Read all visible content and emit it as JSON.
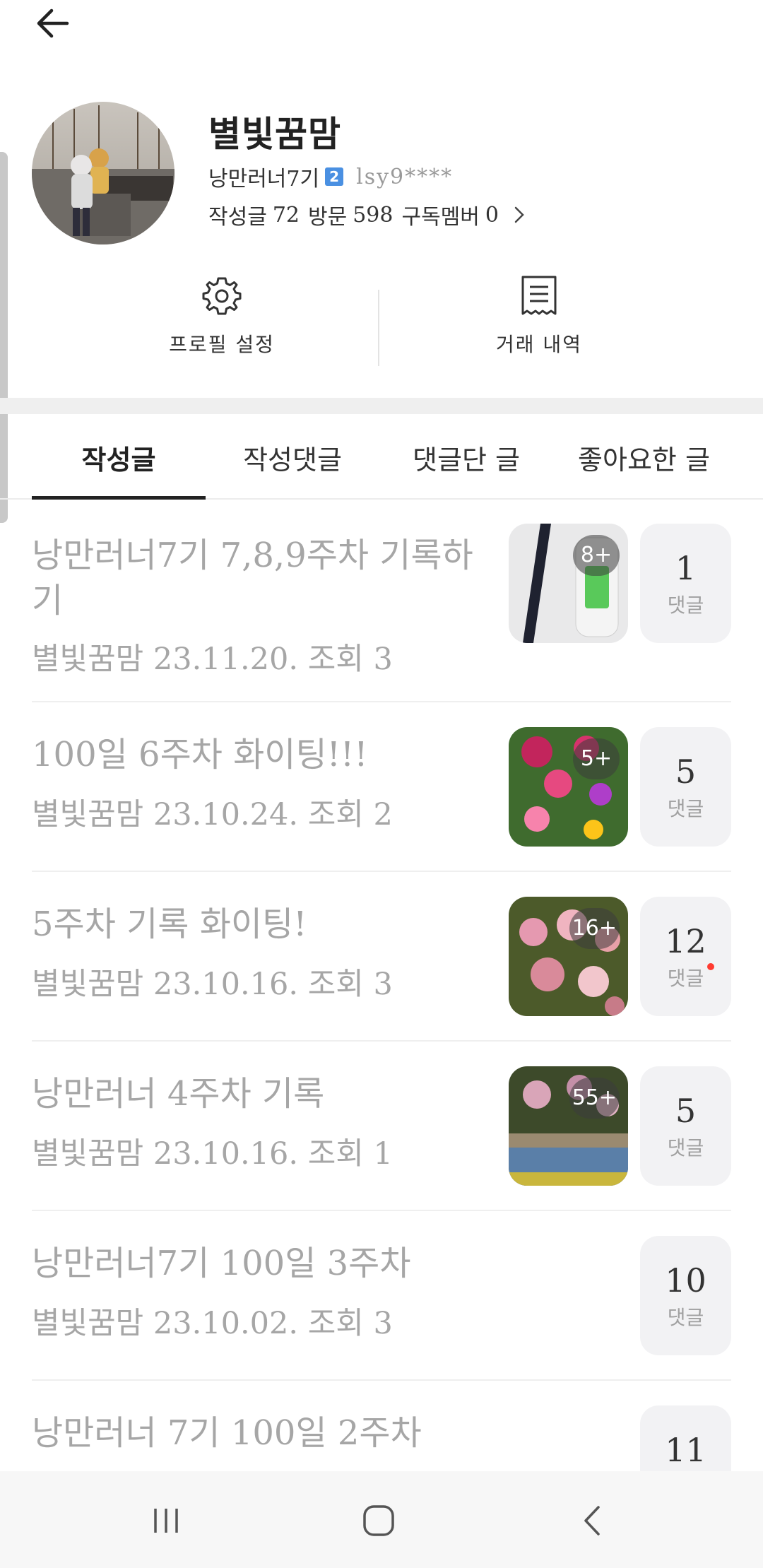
{
  "profile": {
    "nickname": "별빛꿈맘",
    "group": "낭만러너7기",
    "level": "2",
    "user_id": "lsy9****",
    "stats": {
      "posts_label": "작성글",
      "posts": "72",
      "visits_label": "방문",
      "visits": "598",
      "subscribers_label": "구독멤버",
      "subscribers": "0"
    }
  },
  "actions": {
    "profile_settings": "프로필 설정",
    "trade_history": "거래 내역"
  },
  "tabs": [
    {
      "label": "작성글",
      "active": true
    },
    {
      "label": "작성댓글",
      "active": false
    },
    {
      "label": "댓글단 글",
      "active": false
    },
    {
      "label": "좋아요한 글",
      "active": false
    }
  ],
  "posts": [
    {
      "title": "낭만러너7기 7,8,9주차 기록하기",
      "meta": "별빛꿈맘 23.11.20. 조회 3",
      "image_count": "8+",
      "comments": "1",
      "comments_label": "댓글"
    },
    {
      "title": "100일 6주차 화이팅!!!",
      "meta": "별빛꿈맘 23.10.24. 조회 2",
      "image_count": "5+",
      "comments": "5",
      "comments_label": "댓글"
    },
    {
      "title": "5주차 기록 화이팅!",
      "meta": "별빛꿈맘 23.10.16. 조회 3",
      "image_count": "16+",
      "comments": "12",
      "comments_label": "댓글",
      "new_comment": true
    },
    {
      "title": "낭만러너 4주차 기록",
      "meta": "별빛꿈맘 23.10.16. 조회 1",
      "image_count": "55+",
      "comments": "5",
      "comments_label": "댓글"
    },
    {
      "title": "낭만러너7기 100일 3주차",
      "meta": "별빛꿈맘 23.10.02. 조회 3",
      "comments": "10",
      "comments_label": "댓글"
    },
    {
      "title": "낭만러너 7기 100일 2주차",
      "comments": "11"
    }
  ],
  "colors": {
    "accent": "#222222",
    "new_dot": "#ff3b30",
    "level_badge": "#4a90e2"
  },
  "icons": [
    "back-arrow-icon",
    "gear-icon",
    "receipt-icon",
    "chevron-right-icon",
    "recent-apps-icon",
    "home-icon",
    "nav-back-icon"
  ]
}
